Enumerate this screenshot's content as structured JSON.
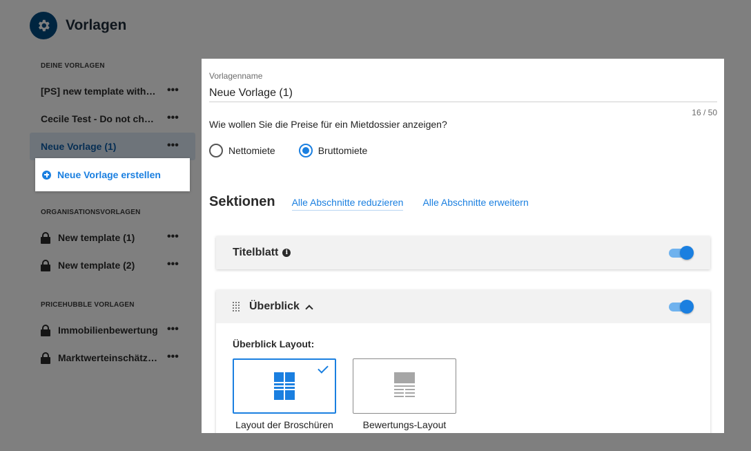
{
  "app": {
    "title": "Vorlagen",
    "logo_icon": "gear-icon"
  },
  "sidebar": {
    "groups": [
      {
        "title": "DEINE VORLAGEN",
        "items": [
          {
            "label": "[PS] new template with a long name",
            "locked": false
          },
          {
            "label": "Cecile Test - Do not change",
            "locked": false
          },
          {
            "label": "Neue Vorlage (1)",
            "locked": false,
            "selected": true
          }
        ]
      },
      {
        "title": "ORGANISATIONSVORLAGEN",
        "items": [
          {
            "label": "New template (1)",
            "locked": true
          },
          {
            "label": "New template (2)",
            "locked": true
          }
        ]
      },
      {
        "title": "PRICEHUBBLE VORLAGEN",
        "items": [
          {
            "label": "Immobilienbewertung",
            "locked": true
          },
          {
            "label": "Marktwerteinschätzung",
            "locked": true
          }
        ]
      }
    ],
    "more_label": "•••",
    "new_template_label": "Neue Vorlage erstellen"
  },
  "modal": {
    "name_label": "Vorlagenname",
    "name_value": "Neue Vorlage (1)",
    "char_count": "16 / 50",
    "price_question": "Wie wollen Sie die Preise für ein Mietdossier anzeigen?",
    "price_options": [
      {
        "label": "Nettomiete",
        "checked": false
      },
      {
        "label": "Bruttomiete",
        "checked": true
      }
    ],
    "sections_title": "Sektionen",
    "collapse_all": "Alle Abschnitte reduzieren",
    "expand_all": "Alle Abschnitte erweitern",
    "sections": [
      {
        "title": "Titelblatt",
        "enabled": true
      },
      {
        "title": "Überblick",
        "enabled": true
      }
    ],
    "overview_layout_label": "Überblick Layout:",
    "layouts": [
      {
        "caption": "Layout der Broschüren",
        "selected": true
      },
      {
        "caption": "Bewertungs-Layout",
        "selected": false
      }
    ]
  },
  "colors": {
    "accent": "#1a7fe0",
    "brand": "#004a80"
  }
}
